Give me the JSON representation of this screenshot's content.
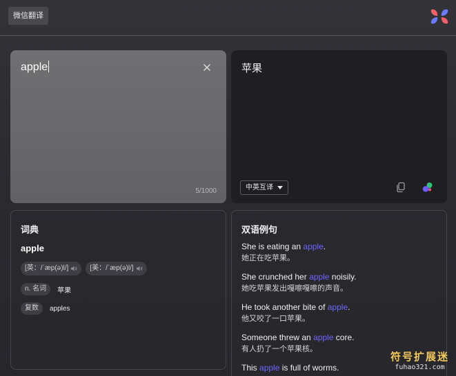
{
  "header": {
    "app_tag": "微信翻译"
  },
  "source": {
    "text": "apple",
    "counter": "5/1000"
  },
  "target": {
    "text": "苹果",
    "lang_select": "中英互译"
  },
  "dictionary": {
    "title": "词典",
    "word": "apple",
    "phonetics": [
      {
        "label": "[英：/ˈæp(ə)l/]"
      },
      {
        "label": "[美：/ˈæp(ə)l/]"
      }
    ],
    "pos_tag": "n. 名词",
    "pos_meaning": "苹果",
    "plural_tag": "复数",
    "plural_value": "apples"
  },
  "examples": {
    "title": "双语例句",
    "items": [
      {
        "en_before": "She is eating an ",
        "hl": "apple",
        "en_after": ".",
        "zh": "她正在吃苹果。"
      },
      {
        "en_before": "She crunched her ",
        "hl": "apple",
        "en_after": " noisily.",
        "zh": "她吃苹果发出嘎嚓嘎嚓的声音。"
      },
      {
        "en_before": "He took another bite of ",
        "hl": "apple",
        "en_after": ".",
        "zh": "他又咬了一口苹果。"
      },
      {
        "en_before": "Someone threw an ",
        "hl": "apple",
        "en_after": " core.",
        "zh": "有人扔了一个苹果核。"
      },
      {
        "en_before": "This ",
        "hl": "apple",
        "en_after": " is full of worms.",
        "zh": ""
      }
    ]
  },
  "watermark": {
    "title": "符号扩展迷",
    "url": "fuhao321.com"
  },
  "colors": {
    "highlight": "#6f66ff",
    "accent_gold": "#f2c95a"
  },
  "icons": [
    "logo-icon",
    "close-icon",
    "chevron-down-icon",
    "copy-icon",
    "ai-dots-icon",
    "speaker-icon"
  ]
}
